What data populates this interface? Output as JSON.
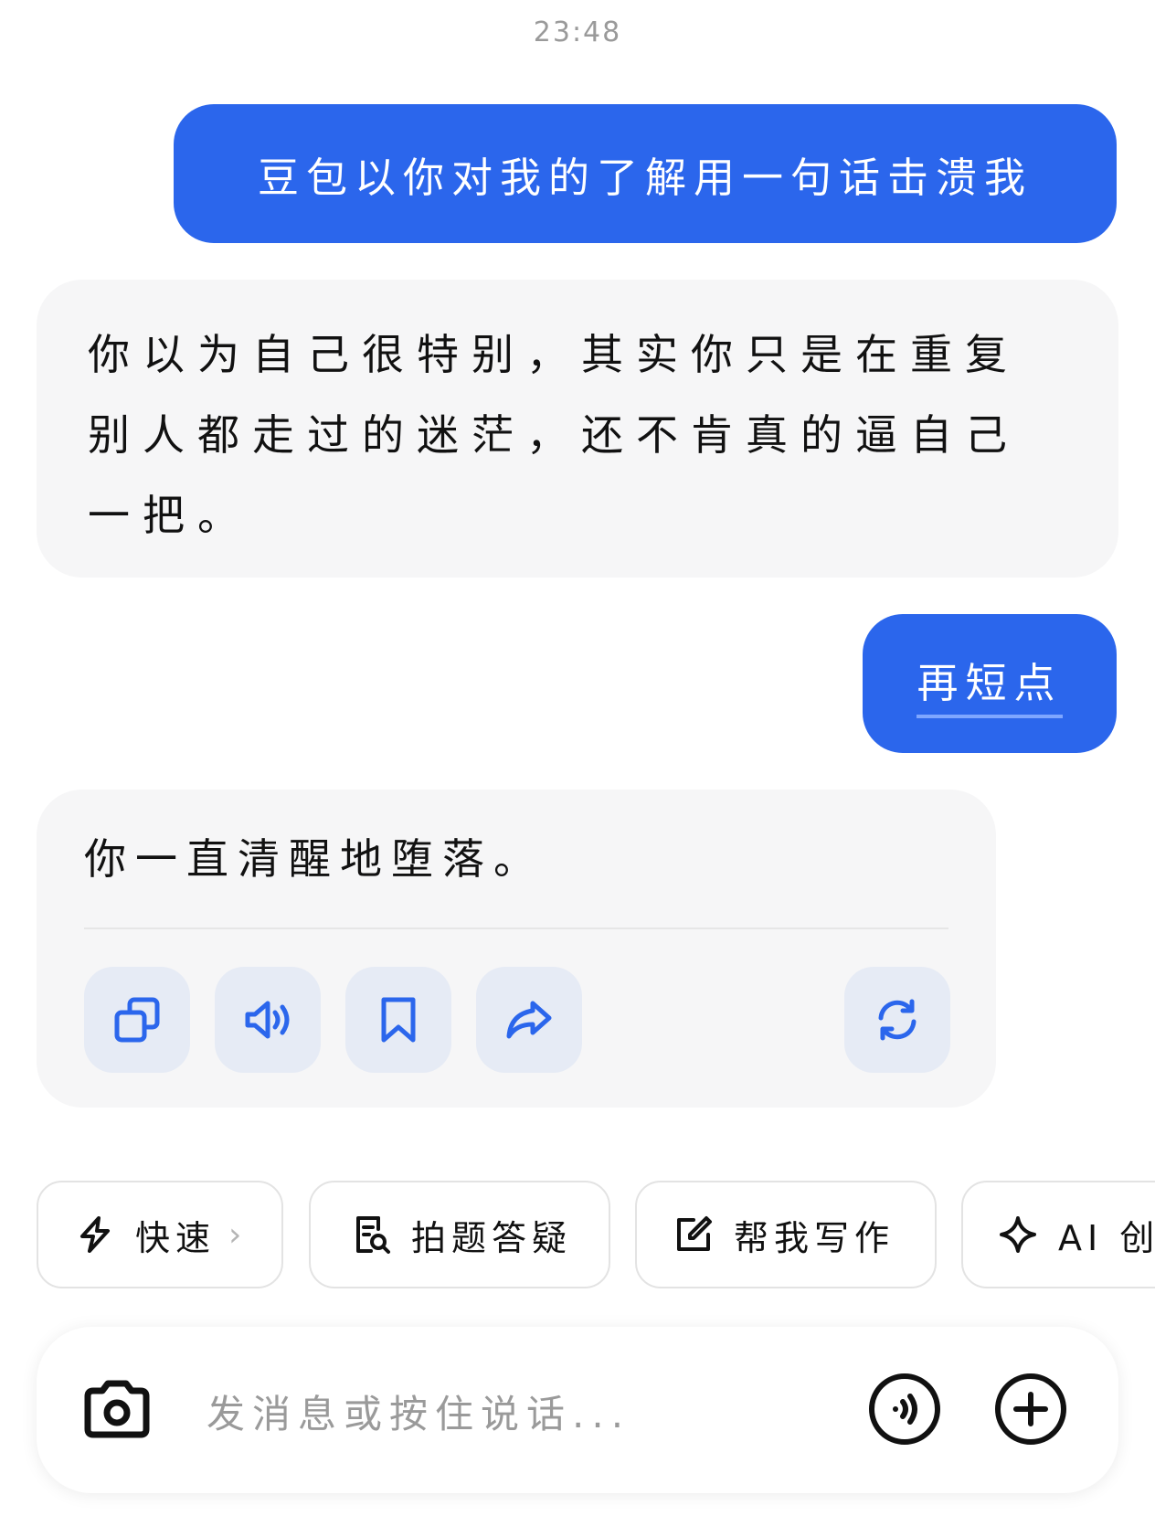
{
  "status_bar": {
    "time": "23:48"
  },
  "messages": [
    {
      "role": "user",
      "text": "豆包以你对我的了解用一句话击溃我"
    },
    {
      "role": "assistant",
      "text": "你以为自己很特别，其实你只是在重复别人都走过的迷茫，还不肯真的逼自己一把。"
    },
    {
      "role": "user",
      "text": "再短点"
    },
    {
      "role": "assistant",
      "text": "你一直清醒地堕落。"
    }
  ],
  "message_actions": [
    "copy-icon",
    "speaker-icon",
    "bookmark-icon",
    "share-icon",
    "regenerate-icon"
  ],
  "quick_chips": [
    {
      "label": "快速",
      "icon": "lightning-icon",
      "has_chevron": true
    },
    {
      "label": "拍题答疑",
      "icon": "photo-question-icon"
    },
    {
      "label": "帮我写作",
      "icon": "edit-icon"
    },
    {
      "label": "AI 创",
      "icon": "sparkle-icon"
    }
  ],
  "composer": {
    "placeholder": "发消息或按住说话...",
    "left_icon": "camera-icon",
    "right_icons": [
      "voice-call-icon",
      "plus-icon"
    ]
  },
  "colors": {
    "user_bubble": "#2b66ec",
    "ai_bubble": "#f6f6f7",
    "action_button": "#e6ebf5",
    "icon_blue": "#2b66ec"
  }
}
